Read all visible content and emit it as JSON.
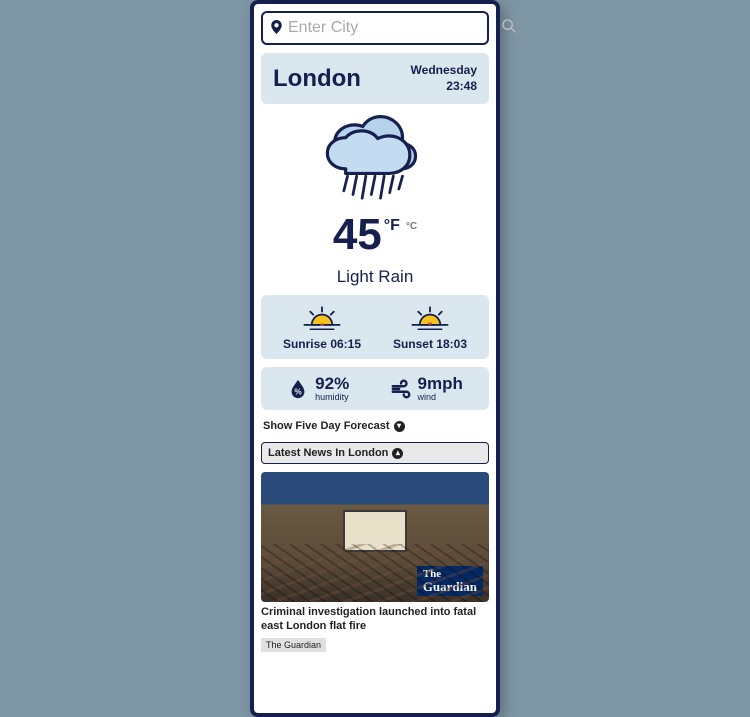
{
  "search": {
    "placeholder": "Enter City"
  },
  "header": {
    "city": "London",
    "day": "Wednesday",
    "time": "23:48"
  },
  "current": {
    "temp": "45",
    "unit_primary": "°F",
    "unit_secondary": "°C",
    "condition": "Light Rain"
  },
  "sun": {
    "sunrise_label": "Sunrise 06:15",
    "sunset_label": "Sunset 18:03"
  },
  "metrics": {
    "humidity_value": "92%",
    "humidity_label": "humidity",
    "wind_value": "9mph",
    "wind_label": "wind"
  },
  "expanders": {
    "forecast": "Show Five Day Forecast",
    "news": "Latest News In London"
  },
  "news": {
    "headline": "Criminal investigation launched into fatal east London flat fire",
    "source": "The Guardian",
    "logo_line1": "The",
    "logo_line2": "Guardian"
  }
}
